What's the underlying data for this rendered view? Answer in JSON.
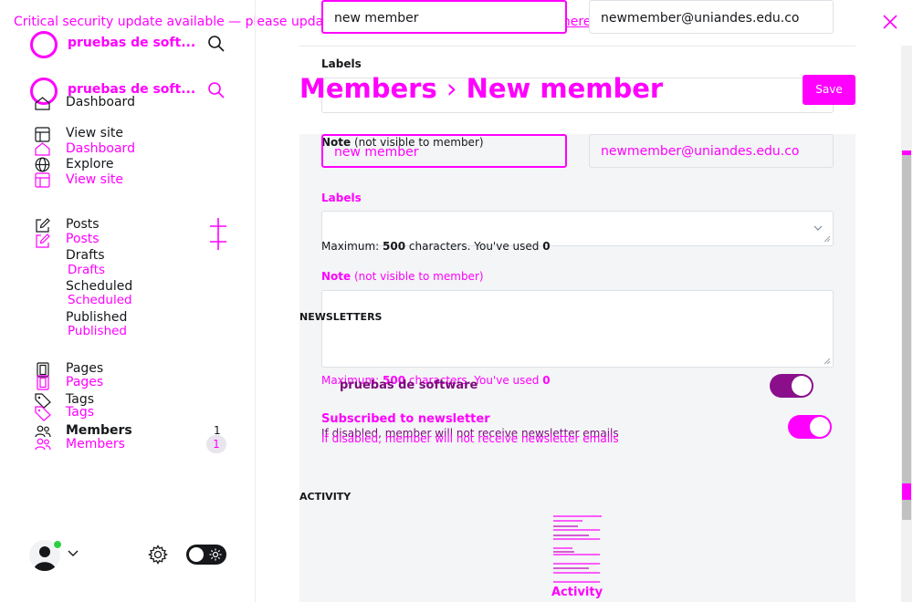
{
  "banner": {
    "text": "Critical security update available — please update Ghost as soon as possible.",
    "link": "Details here."
  },
  "site": {
    "name": "pruebas de soft...",
    "name_ghost": "pruebas de soft..."
  },
  "nav": {
    "dashboard": "Dashboard",
    "view_site": "View site",
    "explore": "Explore",
    "posts": "Posts",
    "drafts": "Drafts",
    "scheduled": "Scheduled",
    "published": "Published",
    "pages": "Pages",
    "tags": "Tags",
    "members": "Members",
    "members_count": "1"
  },
  "header": {
    "breadcrumb_parent": "Members",
    "breadcrumb_sep": "›",
    "title": "New member",
    "save_label": "Save"
  },
  "form": {
    "name_value": "new member",
    "email_value": "newmember@uniandes.edu.co",
    "labels_label": "Labels",
    "note_label": "Note",
    "note_hint": "(not visible to member)",
    "max_prefix": "Maximum:",
    "max_number": "500",
    "max_mid": "characters. You've used",
    "max_used": "0"
  },
  "newsletters": {
    "section_title": "NEWSLETTERS",
    "newsletter_name": "pruebas de software",
    "subscribed_title": "Subscribed to newsletter",
    "subscribed_hint": "If disabled, member will not receive newsletter emails",
    "newsletter_enabled": true,
    "subscribed_enabled": true
  },
  "activity": {
    "section_title": "ACTIVITY",
    "empty_label": "Activity"
  },
  "colors": {
    "accent": "#ff00ff",
    "toggle_dark": "#8b0f8b",
    "online": "#30cf43"
  }
}
